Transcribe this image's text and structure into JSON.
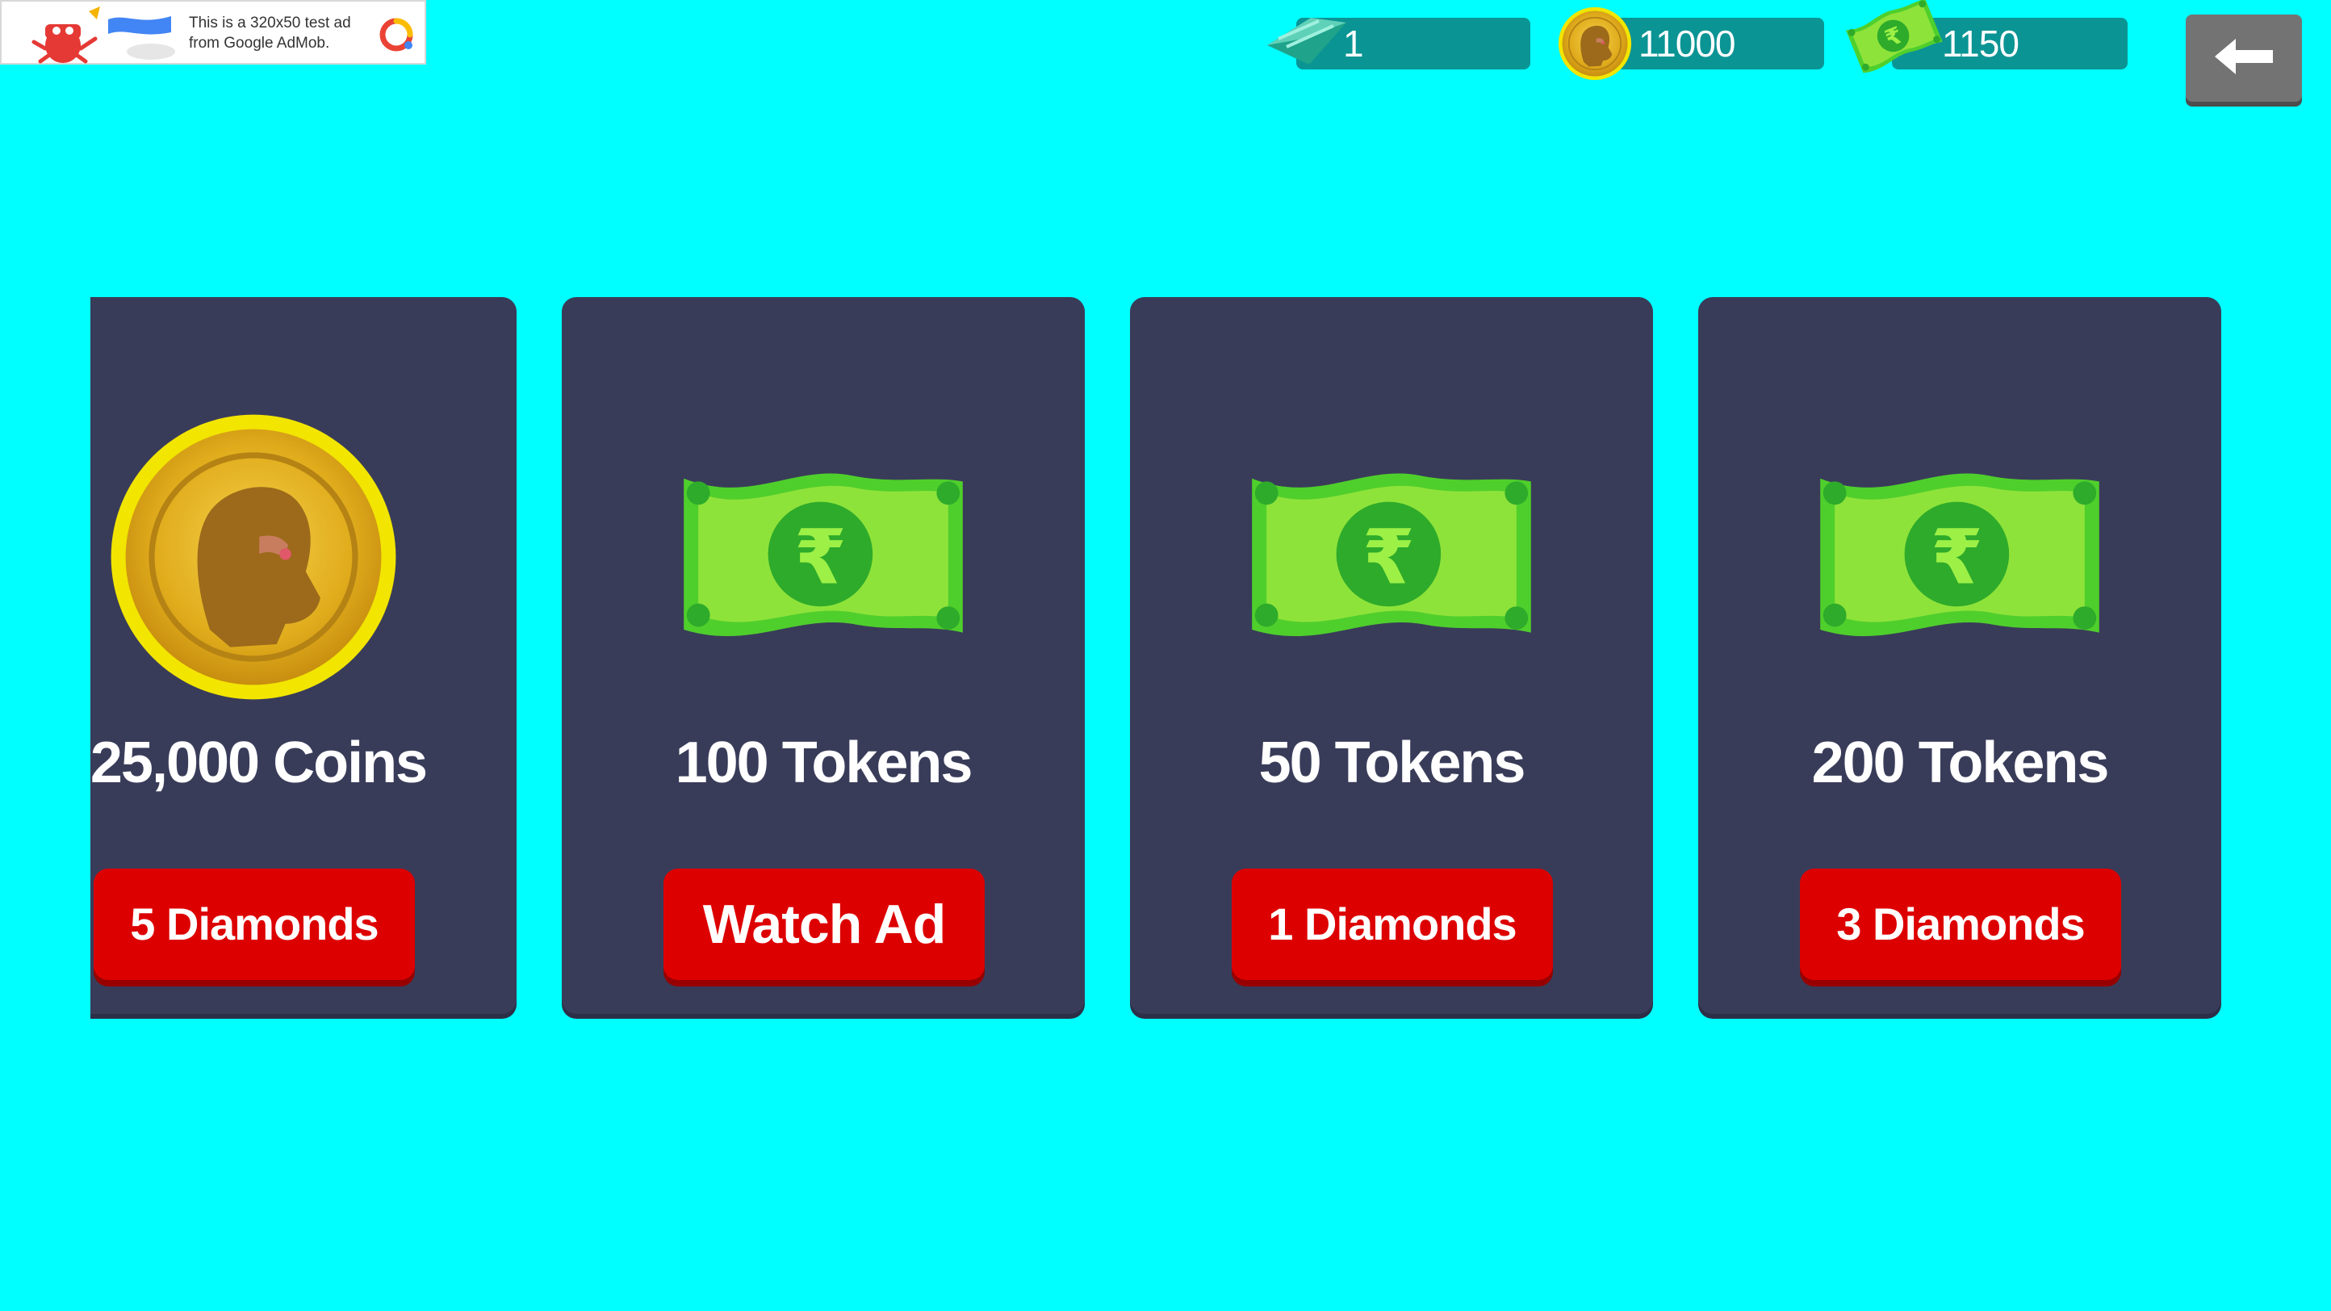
{
  "ad_banner": {
    "text": "This is a 320x50 test ad from Google AdMob.",
    "icon": "admob-logo-icon"
  },
  "currencies": [
    {
      "name": "diamonds",
      "icon": "diamond-icon",
      "value": "1"
    },
    {
      "name": "coins",
      "icon": "coin-icon",
      "value": "11000"
    },
    {
      "name": "tokens",
      "icon": "token-icon",
      "value": "1150"
    }
  ],
  "back_button": {
    "icon": "back-arrow-icon"
  },
  "offers": [
    {
      "label": "25,000 Coins",
      "icon": "coin-icon",
      "button": "5 Diamonds"
    },
    {
      "label": "100 Tokens",
      "icon": "rupee-note-icon",
      "button": "Watch Ad"
    },
    {
      "label": "50 Tokens",
      "icon": "rupee-note-icon",
      "button": "1 Diamonds"
    },
    {
      "label": "200 Tokens",
      "icon": "rupee-note-icon",
      "button": "3 Diamonds"
    }
  ],
  "colors": {
    "background": "#00ffff",
    "card": "#393c59",
    "button": "#dd0000",
    "counter": "#0b9494"
  }
}
